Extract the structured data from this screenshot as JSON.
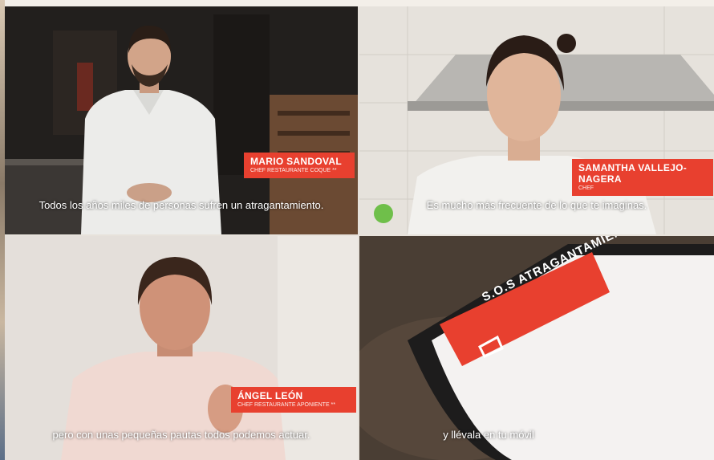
{
  "panels": [
    {
      "person_name": "MARIO SANDOVAL",
      "person_role": "CHEF RESTAURANTE COQUE **",
      "subtitle": "Todos los años miles de personas sufren un atragantamiento."
    },
    {
      "person_name": "SAMANTHA VALLEJO-NAGERA",
      "person_role": "CHEF",
      "subtitle": "Es mucho más frecuente de lo que te imaginas."
    },
    {
      "person_name": "ÁNGEL LEÓN",
      "person_role": "CHEF RESTAURANTE APONIENTE **",
      "subtitle": "pero con unas pequeñas pautas todos podemos actuar."
    },
    {
      "app_logo": "S.O.S ATRAGANTAMIENTO",
      "subtitle": "y llévala en tu móvil"
    }
  ],
  "colors": {
    "accent": "#e8402f"
  }
}
